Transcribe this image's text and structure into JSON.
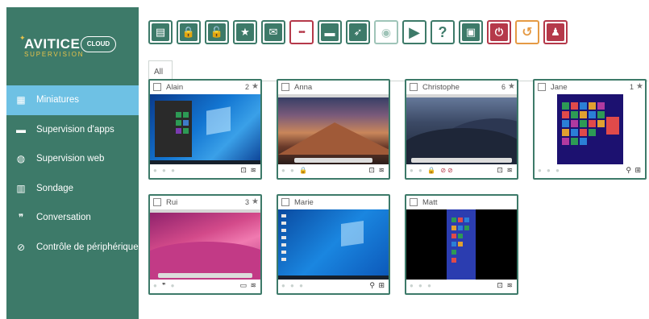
{
  "app": {
    "brand": "AVITICE",
    "brand_sub": "SUPERVISION",
    "brand_cloud": "CLOUD"
  },
  "sidebar": {
    "items": [
      {
        "label": "Miniatures",
        "icon": "grid-icon",
        "active": true
      },
      {
        "label": "Supervision d'apps",
        "icon": "window-icon",
        "active": false
      },
      {
        "label": "Supervision web",
        "icon": "globe-icon",
        "active": false
      },
      {
        "label": "Sondage",
        "icon": "bar-chart-icon",
        "active": false
      },
      {
        "label": "Conversation",
        "icon": "chat-icon",
        "active": false
      },
      {
        "label": "Contrôle de périphérique",
        "icon": "block-icon",
        "active": false
      }
    ]
  },
  "toolbar": {
    "buttons": [
      {
        "icon": "id-card-icon",
        "glyph": "▤",
        "style": "g"
      },
      {
        "icon": "lock-icon",
        "glyph": "🔒",
        "style": "g"
      },
      {
        "icon": "unlock-icon",
        "glyph": "🔓",
        "style": "g"
      },
      {
        "icon": "star-plus-icon",
        "glyph": "★",
        "style": "g"
      },
      {
        "icon": "mail-icon",
        "glyph": "✉",
        "style": "g"
      },
      {
        "icon": "dots-icon",
        "glyph": "•••",
        "style": "r"
      },
      {
        "icon": "monitor-icon",
        "glyph": "▬",
        "style": "g"
      },
      {
        "icon": "rocket-icon",
        "glyph": "➶",
        "style": "g"
      },
      {
        "icon": "eye-icon",
        "glyph": "◉",
        "style": "dim"
      },
      {
        "icon": "play-icon",
        "glyph": "▶",
        "style": "w"
      },
      {
        "icon": "help-icon",
        "glyph": "?",
        "style": "w"
      },
      {
        "icon": "presentation-icon",
        "glyph": "▣",
        "style": "g"
      },
      {
        "icon": "power-icon",
        "glyph": "⏻",
        "style": "r2"
      },
      {
        "icon": "undo-icon",
        "glyph": "↺",
        "style": "o"
      },
      {
        "icon": "user-settings-icon",
        "glyph": "♟",
        "style": "r2"
      }
    ]
  },
  "tabs": [
    {
      "label": "All"
    }
  ],
  "colors": {
    "accent": "#3d7a69",
    "active_nav": "#6ec1e4",
    "danger": "#b5394a",
    "warning": "#e59a44"
  },
  "cards": [
    {
      "name": "Alain",
      "count": "2",
      "screen": "win10",
      "footer_right": "⊡ ≋"
    },
    {
      "name": "Anna",
      "count": "",
      "screen": "sierra",
      "footer_right": "⊡ ≋"
    },
    {
      "name": "Christophe",
      "count": "6",
      "screen": "mojave",
      "footer_right": "⊡ ≋"
    },
    {
      "name": "Jane",
      "count": "1",
      "screen": "win8",
      "footer_right": "⚲ ⊞"
    },
    {
      "name": "Rui",
      "count": "3",
      "screen": "monterey",
      "footer_right": "▭ ≋"
    },
    {
      "name": "Marie",
      "count": "",
      "screen": "win10b",
      "footer_right": "⚲ ⊞"
    },
    {
      "name": "Matt",
      "count": "",
      "screen": "win8b",
      "footer_right": "⊡ ≋"
    }
  ]
}
